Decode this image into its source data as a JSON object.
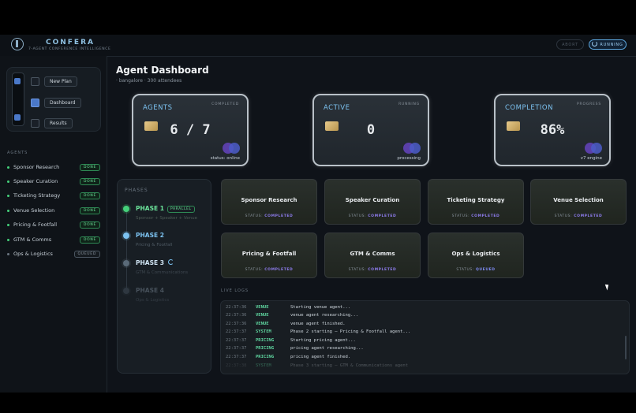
{
  "header": {
    "brand": "CONFERA",
    "tagline": "7-AGENT CONFERENCE INTELLIGENCE",
    "abort_label": "ABORT",
    "running_label": "RUNNING"
  },
  "nav": {
    "items": [
      {
        "label": "New Plan",
        "checked": false
      },
      {
        "label": "Dashboard",
        "checked": true
      },
      {
        "label": "Results",
        "checked": false
      }
    ]
  },
  "sidebar": {
    "section_label": "AGENTS",
    "agents": [
      {
        "name": "Sponsor Research",
        "status": "DONE"
      },
      {
        "name": "Speaker Curation",
        "status": "DONE"
      },
      {
        "name": "Ticketing Strategy",
        "status": "DONE"
      },
      {
        "name": "Venue Selection",
        "status": "DONE"
      },
      {
        "name": "Pricing & Footfall",
        "status": "DONE"
      },
      {
        "name": "GTM & Comms",
        "status": "DONE"
      },
      {
        "name": "Ops & Logistics",
        "status": "QUEUED"
      }
    ]
  },
  "main": {
    "title": "Agent Dashboard",
    "subtitle": "· bangalore · 300 attendees"
  },
  "stats": [
    {
      "label": "AGENTS",
      "tag": "COMPLETED",
      "value": "6 / 7",
      "foot": "status: online"
    },
    {
      "label": "ACTIVE",
      "tag": "RUNNING",
      "value": "0",
      "foot": "processing"
    },
    {
      "label": "COMPLETION",
      "tag": "PROGRESS",
      "value": "86%",
      "foot": "v7 engine"
    }
  ],
  "phases": {
    "header": "PHASES",
    "items": [
      {
        "name": "PHASE 1",
        "badge": "PARALLEL",
        "desc": "Sponsor + Speaker + Venue",
        "color": "#45d07a",
        "text_color": "#6be39a",
        "desc_color": "#4d5a55"
      },
      {
        "name": "PHASE 2",
        "desc": "Pricing & Footfall",
        "color": "#7cc2f0",
        "text_color": "#7cc2f0",
        "desc_color": "#4f5a64"
      },
      {
        "name": "PHASE 3",
        "desc": "GTM & Communications",
        "color": "#5a6a78",
        "text_color": "#cfe3f2",
        "desc_color": "#3e4750"
      },
      {
        "name": "PHASE 4",
        "desc": "Ops & Logistics",
        "color": "#2e3740",
        "text_color": "#47515b",
        "desc_color": "#353d45"
      }
    ]
  },
  "tiles": [
    {
      "name": "Sponsor Research",
      "status_label": "STATUS:",
      "status": "COMPLETED"
    },
    {
      "name": "Speaker Curation",
      "status_label": "STATUS:",
      "status": "COMPLETED"
    },
    {
      "name": "Ticketing Strategy",
      "status_label": "STATUS:",
      "status": "COMPLETED"
    },
    {
      "name": "Venue Selection",
      "status_label": "STATUS:",
      "status": "COMPLETED"
    },
    {
      "name": "Pricing & Footfall",
      "status_label": "STATUS:",
      "status": "COMPLETED"
    },
    {
      "name": "GTM & Comms",
      "status_label": "STATUS:",
      "status": "COMPLETED"
    },
    {
      "name": "Ops & Logistics",
      "status_label": "STATUS:",
      "status": "QUEUED"
    }
  ],
  "logs": {
    "label": "LIVE LOGS",
    "rows": [
      {
        "time": "22:37:36",
        "src": "VENUE",
        "msg": "Starting venue agent..."
      },
      {
        "time": "22:37:36",
        "src": "VENUE",
        "msg": "venue agent researching..."
      },
      {
        "time": "22:37:36",
        "src": "VENUE",
        "msg": "venue agent finished."
      },
      {
        "time": "22:37:37",
        "src": "SYSTEM",
        "msg": "Phase 2 starting — Pricing & Footfall agent..."
      },
      {
        "time": "22:37:37",
        "src": "PRICING",
        "msg": "Starting pricing agent..."
      },
      {
        "time": "22:37:37",
        "src": "PRICING",
        "msg": "pricing agent researching..."
      },
      {
        "time": "22:37:37",
        "src": "PRICING",
        "msg": "pricing agent finished."
      },
      {
        "time": "22:37:38",
        "src": "SYSTEM",
        "msg": "Phase 3 starting — GTM & Communications agent"
      }
    ]
  }
}
